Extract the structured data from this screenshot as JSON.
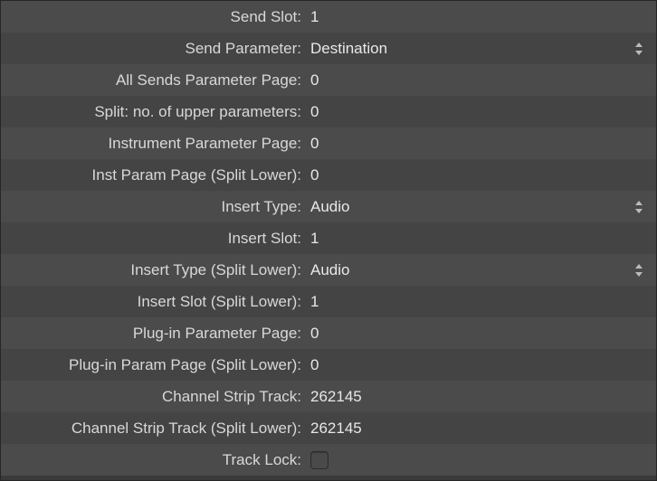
{
  "rows": [
    {
      "label": "Send Slot:",
      "value": "1",
      "type": "text"
    },
    {
      "label": "Send Parameter:",
      "value": "Destination",
      "type": "dropdown"
    },
    {
      "label": "All Sends Parameter Page:",
      "value": "0",
      "type": "text"
    },
    {
      "label": "Split: no. of upper parameters:",
      "value": "0",
      "type": "text"
    },
    {
      "label": "Instrument Parameter Page:",
      "value": "0",
      "type": "text"
    },
    {
      "label": "Inst Param Page (Split Lower):",
      "value": "0",
      "type": "text"
    },
    {
      "label": "Insert Type:",
      "value": "Audio",
      "type": "dropdown"
    },
    {
      "label": "Insert Slot:",
      "value": "1",
      "type": "text"
    },
    {
      "label": "Insert Type (Split Lower):",
      "value": "Audio",
      "type": "dropdown"
    },
    {
      "label": "Insert Slot (Split Lower):",
      "value": "1",
      "type": "text"
    },
    {
      "label": "Plug-in Parameter Page:",
      "value": "0",
      "type": "text"
    },
    {
      "label": "Plug-in Param Page (Split Lower):",
      "value": "0",
      "type": "text"
    },
    {
      "label": "Channel Strip Track:",
      "value": "262145",
      "type": "text"
    },
    {
      "label": "Channel Strip Track (Split Lower):",
      "value": "262145",
      "type": "text"
    },
    {
      "label": "Track Lock:",
      "value": "",
      "type": "checkbox"
    }
  ]
}
